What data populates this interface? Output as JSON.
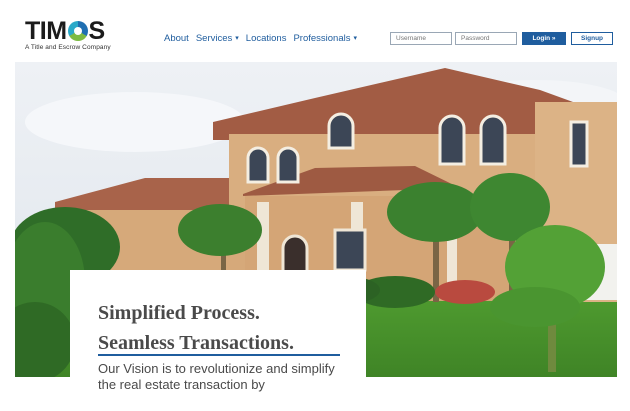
{
  "brand": {
    "name_parts": [
      "TIM",
      "S"
    ],
    "tagline": "A Title and Escrow Company"
  },
  "nav": {
    "items": [
      {
        "label": "About",
        "has_menu": false
      },
      {
        "label": "Services",
        "has_menu": true
      },
      {
        "label": "Locations",
        "has_menu": false
      },
      {
        "label": "Professionals",
        "has_menu": true
      }
    ],
    "caret": "▾"
  },
  "auth": {
    "username_placeholder": "Username",
    "password_placeholder": "Password",
    "login_label": "Login »",
    "signup_label": "Signup"
  },
  "hero": {
    "headline_line1": "Simplified Process.",
    "headline_line2": "Seamless Transactions.",
    "body": "Our Vision is to revolutionize and simplify the real estate transaction by"
  },
  "colors": {
    "brand_blue": "#1f5d9e",
    "brand_green": "#7dbb43",
    "brand_teal": "#2aa9c9"
  }
}
